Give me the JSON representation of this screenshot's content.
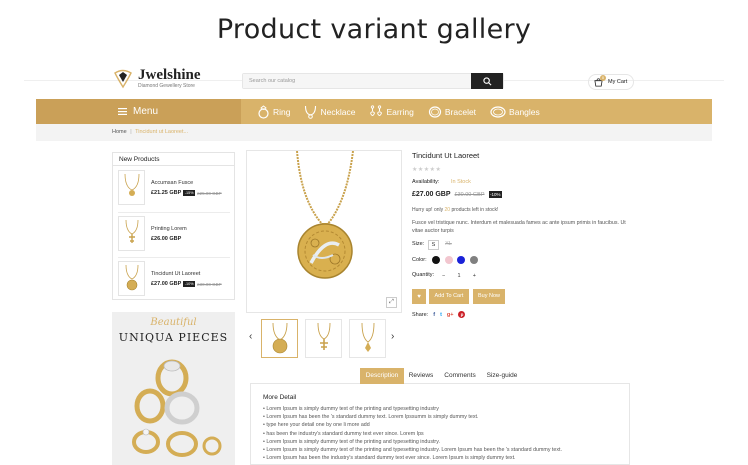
{
  "banner": {
    "title": "Product variant gallery"
  },
  "header": {
    "logo_name": "Jwelshine",
    "logo_tagline": "Diamond Gewellery Store",
    "search_placeholder": "Search our catalog",
    "cart_label": "My Cart",
    "cart_count": "0"
  },
  "nav": {
    "menu_label": "Menu",
    "items": [
      {
        "label": "Ring",
        "icon": "ring-icon"
      },
      {
        "label": "Necklace",
        "icon": "necklace-icon"
      },
      {
        "label": "Earring",
        "icon": "earring-icon"
      },
      {
        "label": "Bracelet",
        "icon": "bracelet-icon"
      },
      {
        "label": "Bangles",
        "icon": "bangles-icon"
      }
    ]
  },
  "breadcrumb": {
    "home": "Home",
    "separator": "|",
    "current": "Tincidunt ut Laoreet..."
  },
  "new_products": {
    "title": "New Products",
    "items": [
      {
        "name": "Accumsan Fusce",
        "price": "£21.25 GBP",
        "badge": "-15%",
        "old_price": "£25.00 GBP"
      },
      {
        "name": "Printing Lorem",
        "price": "£26.00 GBP",
        "badge": "",
        "old_price": ""
      },
      {
        "name": "Tincidunt Ut Laoreet",
        "price": "£27.00 GBP",
        "badge": "-10%",
        "old_price": "£30.00 GBP"
      }
    ]
  },
  "promo": {
    "line1": "Beautiful",
    "line2": "UNIQUA PIECES"
  },
  "product": {
    "title": "Tincidunt Ut Laoreet",
    "rating": "★★★★★",
    "availability_label": "Availability:",
    "availability_value": "In Stock",
    "price": "£27.00 GBP",
    "old_price": "£30.00 GBP",
    "discount": "-10%",
    "hurry_prefix": "Hurry up! only",
    "hurry_count": "20",
    "hurry_suffix": "products left in stock!",
    "description": "Fusce vel tristique nunc. Interdum et malesuada fames ac ante ipsum primis in faucibus. Ut vitae auctor turpis",
    "size_label": "Size:",
    "sizes": [
      "S",
      "XL"
    ],
    "color_label": "Color:",
    "colors": [
      "#111111",
      "#f2c6cf",
      "#1a22d8",
      "#808080"
    ],
    "quantity_label": "Quantity:",
    "qty_minus": "−",
    "qty_value": "1",
    "qty_plus": "+",
    "wishlist_icon_glyph": "♥",
    "add_to_cart": "Add To Cart",
    "buy_now": "Buy Now",
    "share_label": "Share:",
    "share_glyphs": [
      "f",
      "t",
      "g+",
      "p"
    ]
  },
  "gallery": {
    "zoom_glyph": "⤢",
    "prev": "‹",
    "next": "›"
  },
  "tabs": [
    "Description",
    "Reviews",
    "Comments",
    "Size-guide"
  ],
  "details": {
    "title": "More Detail",
    "lines": [
      "Lorem Ipsum is simply dummy text of the printing and typesetting industry",
      "Lorem Ipsum has been the 's standard dummy text. Lorem Ipssumm is simply dummy text.",
      "type here your detail one by one li more add",
      "has been the industry's standard dummy text ever since. Lorem Ips",
      "Lorem Ipsum is simply dummy text of the printing and typesetting industry.",
      "Lorem Ipsum is simply dummy text of the printing and typesetting industry. Lorem Ipsum has been the 's standard dummy text.",
      "Lorem Ipsum has been the industry's standard dummy text ever since. Lorem Ipsum is simply dummy text."
    ]
  },
  "accent_color": "#d9b36a"
}
